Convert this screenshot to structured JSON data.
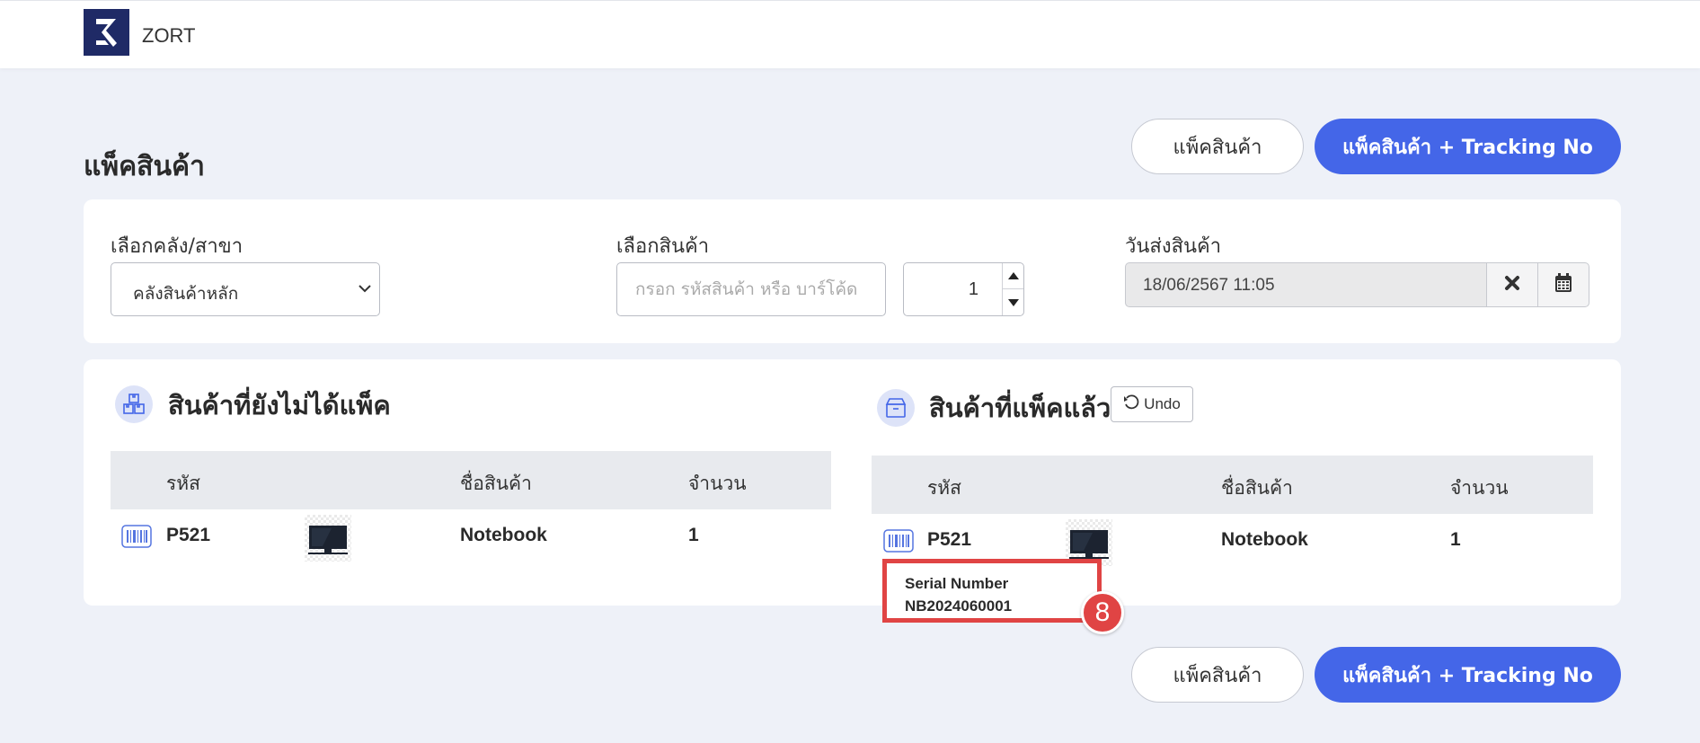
{
  "app": {
    "brand": "ZORT"
  },
  "page": {
    "title": "แพ็คสินค้า"
  },
  "actions": {
    "pack_label": "แพ็คสินค้า",
    "pack_tracking_label": "แพ็คสินค้า + Tracking No"
  },
  "filters": {
    "warehouse_label": "เลือกคลัง/สาขา",
    "warehouse_value": "คลังสินค้าหลัก",
    "product_label": "เลือกสินค้า",
    "product_placeholder": "กรอก รหัสสินค้า หรือ บาร์โค้ด",
    "quantity_value": "1",
    "ship_date_label": "วันส่งสินค้า",
    "ship_date_value": "18/06/2567 11:05"
  },
  "unpacked": {
    "title": "สินค้าที่ยังไม่ได้แพ็ค",
    "columns": {
      "code": "รหัส",
      "name": "ชื่อสินค้า",
      "qty": "จำนวน"
    },
    "rows": [
      {
        "code": "P521",
        "name": "Notebook",
        "qty": "1"
      }
    ]
  },
  "packed": {
    "title": "สินค้าที่แพ็คแล้ว",
    "undo_label": "Undo",
    "columns": {
      "code": "รหัส",
      "name": "ชื่อสินค้า",
      "qty": "จำนวน"
    },
    "rows": [
      {
        "code": "P521",
        "name": "Notebook",
        "qty": "1",
        "serial_label": "Serial Number",
        "serial_value": "NB2024060001"
      }
    ]
  },
  "annotation": {
    "badge": "8"
  },
  "colors": {
    "primary": "#4466e8",
    "highlight": "#e04444",
    "logo_bg": "#1f2a66",
    "background": "#eef1f8"
  },
  "icons": {
    "logo": "zort-logo-icon",
    "dropdown": "chevron-down-icon",
    "clear": "close-icon",
    "calendar": "calendar-icon",
    "unpacked": "boxes-icon",
    "packed": "box-icon",
    "undo": "undo-icon",
    "barcode": "barcode-icon",
    "product": "monitor-icon"
  }
}
